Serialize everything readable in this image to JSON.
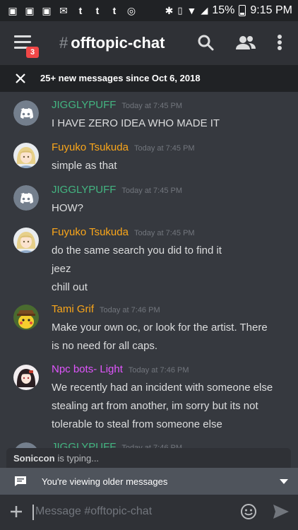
{
  "status_bar": {
    "left_icons": [
      "gamepad-icon",
      "gamepad-icon",
      "gamepad-icon",
      "mail-icon",
      "tumblr-icon",
      "tumblr-icon",
      "tumblr-icon",
      "instagram-icon"
    ],
    "left_glyphs": [
      "▣",
      "▣",
      "▣",
      "✉",
      "t",
      "t",
      "t",
      "◎"
    ],
    "battery_percent": "15%",
    "time": "9:15 PM"
  },
  "header": {
    "channel_name": "offtopic-chat",
    "hash": "#",
    "notification_count": "3"
  },
  "banner": {
    "text": "25+ new messages since Oct 6, 2018"
  },
  "messages": [
    {
      "author": "JIGGLYPUFF",
      "color": "#43b581",
      "timestamp": "Today at 7:45 PM",
      "avatar": "discord-logo-icon",
      "lines": [
        "I HAVE ZERO IDEA WHO MADE IT"
      ]
    },
    {
      "author": "Fuyuko Tsukuda",
      "color": "#faa61a",
      "timestamp": "Today at 7:45 PM",
      "avatar": "anime-girl-blonde-avatar",
      "lines": [
        "simple as that"
      ]
    },
    {
      "author": "JIGGLYPUFF",
      "color": "#43b581",
      "timestamp": "Today at 7:45 PM",
      "avatar": "discord-logo-icon",
      "lines": [
        "HOW?"
      ]
    },
    {
      "author": "Fuyuko Tsukuda",
      "color": "#faa61a",
      "timestamp": "Today at 7:45 PM",
      "avatar": "anime-girl-blonde-avatar",
      "lines": [
        "do the same search you did to find it",
        "jeez",
        "chill out"
      ]
    },
    {
      "author": "Tami Grif",
      "color": "#faa61a",
      "timestamp": "Today at 7:46 PM",
      "avatar": "pikachu-detective-avatar",
      "lines": [
        "Make your own oc, or look for the artist. There",
        "is no need for all caps."
      ]
    },
    {
      "author": "Npc bots- Light",
      "color": "#e056fd",
      "timestamp": "Today at 7:46 PM",
      "avatar": "anime-girl-dark-hair-avatar",
      "lines": [
        "We recently had an incident with someone else",
        "stealing art from another, im sorry but its not",
        "tolerable to steal from someone else"
      ]
    },
    {
      "author": "JIGGLYPUFF",
      "color": "#43b581",
      "timestamp": "Today at 7:46 PM",
      "avatar": "discord-logo-icon",
      "lines": []
    }
  ],
  "typing": {
    "user": "Soniccon",
    "text": "is typing..."
  },
  "older_bar": {
    "text": "You're viewing older messages"
  },
  "composer": {
    "placeholder": "Message #offtopic-chat"
  },
  "colors": {
    "background": "#36393f",
    "header": "#2f3136",
    "accent_green": "#43b581",
    "accent_orange": "#faa61a",
    "accent_pink": "#e056fd",
    "badge_red": "#f04747"
  }
}
